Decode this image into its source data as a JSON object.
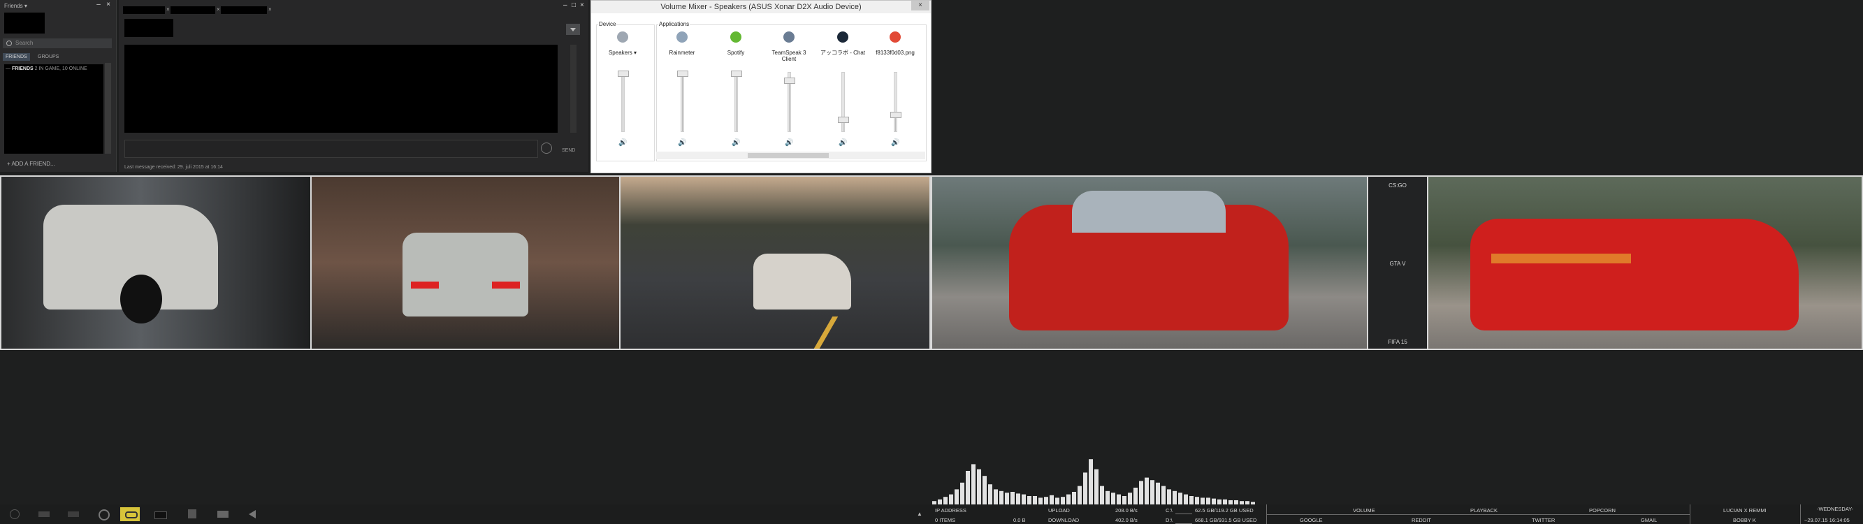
{
  "friends": {
    "title": "Friends ▾",
    "search_placeholder": "Search",
    "tabs": [
      "FRIENDS",
      "GROUPS"
    ],
    "group_title": "FRIENDS",
    "group_status": "2 IN GAME, 10 ONLINE",
    "add_friend": "+ ADD A FRIEND..."
  },
  "chat": {
    "last_message": "Last message received: 29. juli 2015 at 16:14",
    "send_label": "SEND"
  },
  "mixer": {
    "title": "Volume Mixer - Speakers (ASUS Xonar D2X Audio Device)",
    "device_group": "Device",
    "apps_group": "Applications",
    "channels": [
      {
        "name": "Speakers ▾",
        "level": 0.0,
        "icon": "speaker-device-icon",
        "color": "#9ea7b2"
      },
      {
        "name": "Rainmeter",
        "level": 0.0,
        "icon": "rainmeter-icon",
        "color": "#8fa3b8"
      },
      {
        "name": "Spotify",
        "level": 0.0,
        "icon": "spotify-icon",
        "color": "#63b832"
      },
      {
        "name": "TeamSpeak 3 Client",
        "level": 0.12,
        "icon": "teamspeak-icon",
        "color": "#6a7c93"
      },
      {
        "name": "アッコラボ - Chat",
        "level": 0.78,
        "icon": "steam-icon",
        "color": "#1b2838"
      },
      {
        "name": "f8133f0d03.png",
        "level": 0.7,
        "icon": "chrome-icon",
        "color": "#e24a36"
      }
    ]
  },
  "games": [
    "CS:GO",
    "GTA V",
    "FIFA 15"
  ],
  "visualizer_levels": [
    4,
    6,
    9,
    12,
    18,
    26,
    40,
    48,
    42,
    34,
    24,
    18,
    16,
    14,
    15,
    13,
    12,
    10,
    10,
    8,
    9,
    11,
    8,
    9,
    12,
    15,
    22,
    38,
    54,
    42,
    22,
    16,
    14,
    12,
    10,
    14,
    20,
    28,
    32,
    29,
    26,
    22,
    18,
    16,
    14,
    12,
    10,
    9,
    8,
    8,
    7,
    6,
    6,
    5,
    5,
    4,
    4,
    3
  ],
  "stats": {
    "ip_label": "IP ADDRESS",
    "items_label": "0 ITEMS",
    "items_size": "0.0 B",
    "upload_label": "UPLOAD",
    "upload_value": "208.0 B/s",
    "download_label": "DOWNLOAD",
    "download_value": "402.0 B/s",
    "drive_c": "C:\\",
    "drive_c_usage": "62.5 GB/119.2 GB USED",
    "drive_d": "D:\\",
    "drive_d_usage": "668.1 GB/931.5 GB USED"
  },
  "links_top": [
    "VOLUME",
    "PLAYBACK",
    "POPCORN"
  ],
  "links_bottom": [
    "GOOGLE",
    "REDDIT",
    "TWITTER",
    "GMAIL"
  ],
  "now_playing": {
    "title": "LUCIAN X REMMI",
    "artist": "BOBBY K"
  },
  "clock": {
    "weekday": "-WEDNESDAY-",
    "date_time": "~29.07.15  16:14:05"
  },
  "colors": {
    "accent": "#1a66c2",
    "spotify": "#63b832",
    "active_task": "#d7c43a"
  }
}
